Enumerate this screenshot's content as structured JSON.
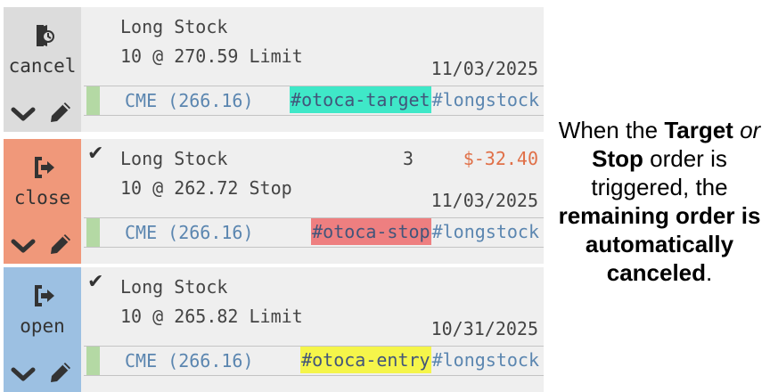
{
  "orders": [
    {
      "action": "cancel",
      "action_icon": "cancel-order-icon",
      "side_color": "#dcdcdc",
      "checked": false,
      "title": "Long Stock",
      "detail": "10 @ 270.59 Limit",
      "qty": "",
      "pnl": "",
      "date": "11/03/2025",
      "exchange": "CME (266.16)",
      "tag": "#otoca-target",
      "tag_color": "#3fe8c8",
      "tag2": "#longstock"
    },
    {
      "action": "close",
      "action_icon": "close-position-icon",
      "side_color": "#f0987a",
      "checked": true,
      "title": "Long Stock",
      "detail": "10 @ 262.72 Stop",
      "qty": "3",
      "pnl": "$-32.40",
      "date": "11/03/2025",
      "exchange": "CME (266.16)",
      "tag": "#otoca-stop",
      "tag_color": "#ee7f80",
      "tag2": "#longstock"
    },
    {
      "action": "open",
      "action_icon": "open-position-icon",
      "side_color": "#9cc0e2",
      "checked": true,
      "title": "Long Stock",
      "detail": "10 @ 265.82 Limit",
      "qty": "",
      "pnl": "",
      "date": "10/31/2025",
      "exchange": "CME (266.16)",
      "tag": "#otoca-entry",
      "tag_color": "#f5f54a",
      "tag2": "#longstock"
    }
  ],
  "caption": {
    "p1": "When the ",
    "b1": "Target",
    "p2": " ",
    "i1": "or",
    "p3": " ",
    "b2": "Stop",
    "p4": " order is triggered, the ",
    "b3": "remaining order is automatically canceled",
    "p5": "."
  }
}
